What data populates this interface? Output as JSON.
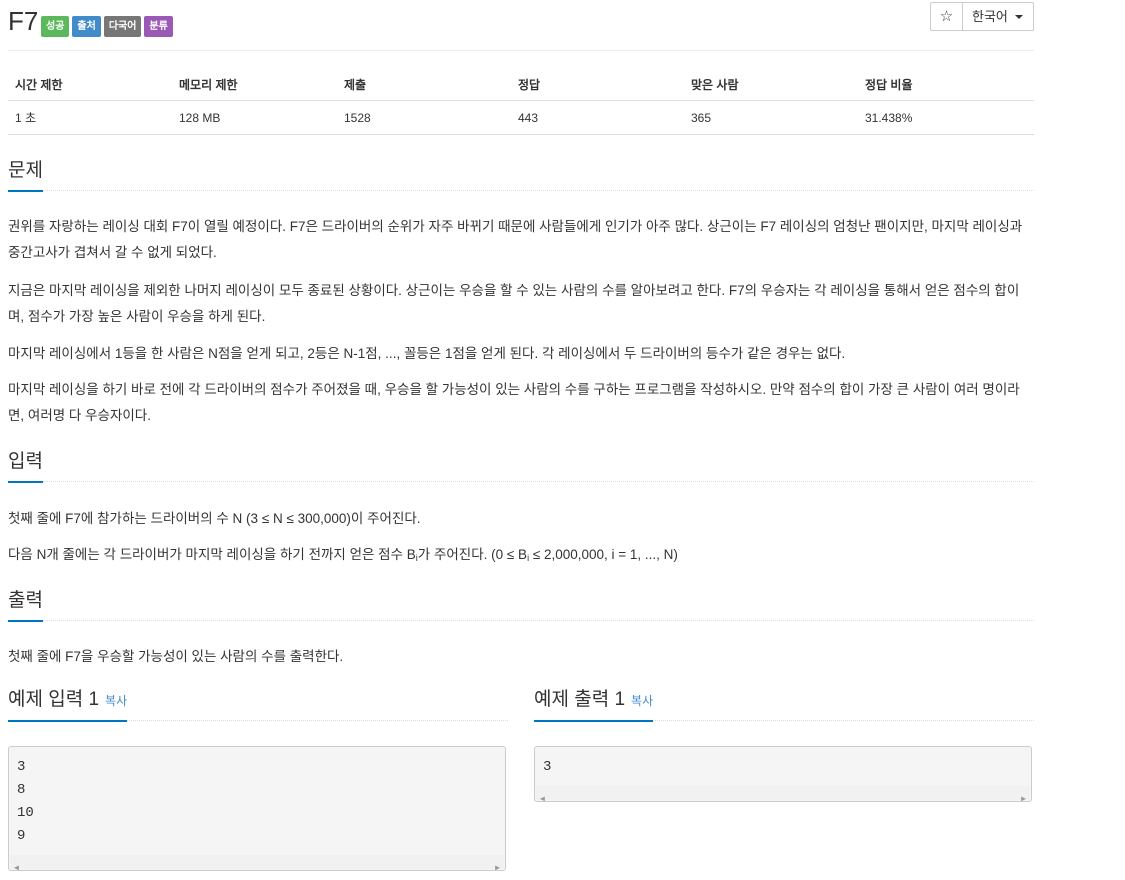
{
  "problem": {
    "title": "F7",
    "labels": [
      "성공",
      "출처",
      "다국어",
      "분류"
    ]
  },
  "controls": {
    "star_icon": "star-icon",
    "star_glyph": "☆",
    "language": "한국어"
  },
  "info_table": {
    "headers": [
      "시간 제한",
      "메모리 제한",
      "제출",
      "정답",
      "맞은 사람",
      "정답 비율"
    ],
    "row": [
      "1 초",
      "128 MB",
      "1528",
      "443",
      "365",
      "31.438%"
    ]
  },
  "sections": {
    "problem": {
      "title": "문제",
      "paragraphs": [
        "권위를 자랑하는 레이싱 대회 F7이 열릴 예정이다. F7은 드라이버의 순위가 자주 바뀌기 때문에 사람들에게 인기가 아주 많다. 상근이는 F7 레이싱의 엄청난 팬이지만, 마지막 레이싱과 중간고사가 겹쳐서 갈 수 없게 되었다.",
        "지금은 마지막 레이싱을 제외한 나머지 레이싱이 모두 종료된 상황이다. 상근이는 우승을 할 수 있는 사람의 수를 알아보려고 한다. F7의 우승자는 각 레이싱을 통해서 얻은 점수의 합이며, 점수가 가장 높은 사람이 우승을 하게 된다.",
        "마지막 레이싱에서 1등을 한 사람은 N점을 얻게 되고, 2등은 N-1점, ..., 꼴등은 1점을 얻게 된다. 각 레이싱에서 두 드라이버의 등수가 같은 경우는 없다.",
        "마지막 레이싱을 하기 바로 전에 각 드라이버의 점수가 주어졌을 때, 우승을 할 가능성이 있는 사람의 수를 구하는 프로그램을 작성하시오. 만약 점수의 합이 가장 큰 사람이 여러 명이라면, 여러명 다 우승자이다."
      ]
    },
    "input": {
      "title": "입력",
      "line1": "첫째 줄에 F7에 참가하는 드라이버의 수 N (3 ≤ N ≤ 300,000)이 주어진다.",
      "line2_before": "다음 N개 줄에는 각 드라이버가 마지막 레이싱을 하기 전까지 얻은 점수 B",
      "line2_sub": "i",
      "line2_mid": "가 주어진다. (0 ≤ B",
      "line2_sub2": "i",
      "line2_after": " ≤ 2,000,000, i = 1, ..., N)"
    },
    "output": {
      "title": "출력",
      "line1": "첫째 줄에 F7을 우승할 가능성이 있는 사람의 수를 출력한다."
    }
  },
  "samples": {
    "input_title": "예제 입력 1",
    "output_title": "예제 출력 1",
    "copy_label": "복사",
    "input_lines": [
      "3",
      "8",
      "10",
      "9"
    ],
    "output_lines": [
      "3"
    ]
  },
  "colors": {
    "accent": "#0076c0",
    "success": "#5cb85c",
    "source": "#428bca",
    "multilang": "#777777",
    "category": "#9b59b6"
  }
}
